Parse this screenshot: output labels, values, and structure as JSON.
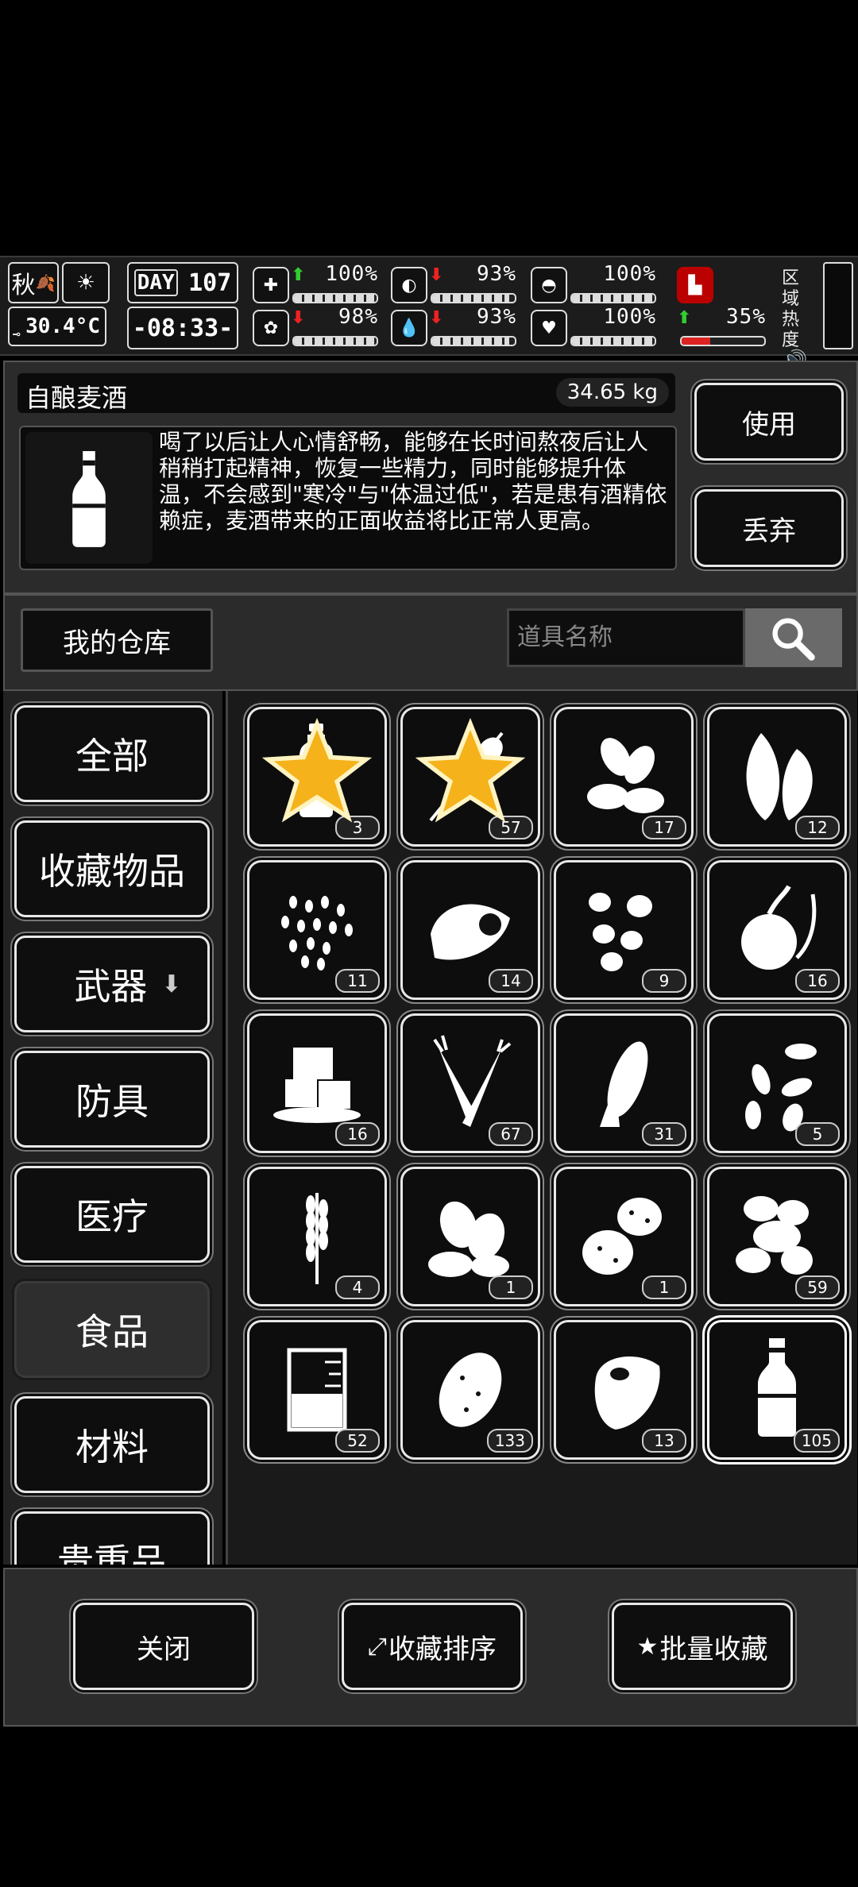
{
  "status": {
    "season": "秋",
    "temperature": "30.4°C",
    "day_label": "DAY",
    "day_number": "107",
    "time": "-08:33-",
    "stats": [
      {
        "icon": "medkit-icon",
        "glyph": "✚",
        "arrow": "up",
        "value": "100%",
        "level": 1.0
      },
      {
        "icon": "stomach-icon",
        "glyph": "◐",
        "arrow": "down",
        "value": "93%",
        "level": 0.93
      },
      {
        "icon": "pill-icon",
        "glyph": "◓",
        "arrow": "none",
        "value": "100%",
        "level": 1.0
      },
      {
        "icon": "brain-icon",
        "glyph": "✿",
        "arrow": "down",
        "value": "98%",
        "level": 0.98
      },
      {
        "icon": "water-drop-icon",
        "glyph": "💧",
        "arrow": "down",
        "value": "93%",
        "level": 0.93
      },
      {
        "icon": "heart-icon",
        "glyph": "♥",
        "arrow": "none",
        "value": "100%",
        "level": 1.0
      }
    ],
    "special_stat": {
      "icon": "boot-icon",
      "arrow": "up",
      "value": "35%",
      "level": 0.35
    },
    "region_heat_label_1": "区域",
    "region_heat_label_2": "热度"
  },
  "item": {
    "name": "自酿麦酒",
    "weight": "34.65 kg",
    "icon": "beer-bottle-icon",
    "description": "喝了以后让人心情舒畅，能够在长时间熬夜后让人稍稍打起精神，恢复一些精力，同时能够提升体温，不会感到\"寒冷\"与\"体温过低\"，若是患有酒精依赖症，麦酒带来的正面收益将比正常人更高。",
    "use_label": "使用",
    "discard_label": "丢弃"
  },
  "warehouse": {
    "title": "我的仓库",
    "search_placeholder": "道具名称"
  },
  "categories": [
    {
      "label": "全部",
      "selected": false
    },
    {
      "label": "收藏物品",
      "selected": false
    },
    {
      "label": "武器",
      "selected": false,
      "has_arrow": true
    },
    {
      "label": "防具",
      "selected": false
    },
    {
      "label": "医疗",
      "selected": false
    },
    {
      "label": "食品",
      "selected": true
    },
    {
      "label": "材料",
      "selected": false
    },
    {
      "label": "贵重品",
      "selected": false
    }
  ],
  "items": [
    {
      "icon": "water-bottle-icon",
      "count": "3",
      "favorite": true
    },
    {
      "icon": "meat-skewer-icon",
      "count": "57",
      "favorite": true
    },
    {
      "icon": "almonds-icon",
      "count": "17",
      "favorite": false
    },
    {
      "icon": "leaves-icon",
      "count": "12",
      "favorite": false
    },
    {
      "icon": "rice-grains-icon",
      "count": "11",
      "favorite": false
    },
    {
      "icon": "fish-head-icon",
      "count": "14",
      "favorite": false
    },
    {
      "icon": "peanuts-icon",
      "count": "9",
      "favorite": false
    },
    {
      "icon": "onion-icon",
      "count": "16",
      "favorite": false
    },
    {
      "icon": "ice-cubes-icon",
      "count": "16",
      "favorite": false
    },
    {
      "icon": "carrots-icon",
      "count": "67",
      "favorite": false
    },
    {
      "icon": "corn-icon",
      "count": "31",
      "favorite": false
    },
    {
      "icon": "seeds-icon",
      "count": "5",
      "favorite": false
    },
    {
      "icon": "wheat-icon",
      "count": "4",
      "favorite": false
    },
    {
      "icon": "beans-icon",
      "count": "1",
      "favorite": false
    },
    {
      "icon": "potatoes-icon",
      "count": "1",
      "favorite": false
    },
    {
      "icon": "ginger-icon",
      "count": "59",
      "favorite": false
    },
    {
      "icon": "beaker-icon",
      "count": "52",
      "favorite": false
    },
    {
      "icon": "potato-icon",
      "count": "133",
      "favorite": false
    },
    {
      "icon": "steak-icon",
      "count": "13",
      "favorite": false
    },
    {
      "icon": "beer-bottle-icon",
      "count": "105",
      "favorite": false,
      "selected": true
    }
  ],
  "bottom": {
    "close_label": "关闭",
    "sort_label": "收藏排序",
    "batch_label": "批量收藏"
  }
}
